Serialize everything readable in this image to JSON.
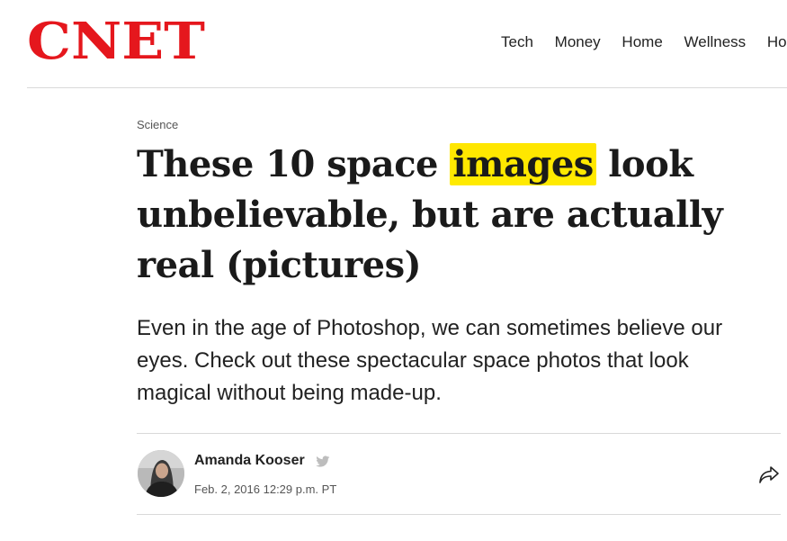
{
  "site": {
    "logo_text": "CNET",
    "brand_color": "#e5171d"
  },
  "nav": {
    "items": [
      "Tech",
      "Money",
      "Home",
      "Wellness",
      "Home Tips"
    ]
  },
  "article": {
    "section": "Science",
    "headline": {
      "before": "These 10 space ",
      "highlighted": "images",
      "after": " look unbelievable, but are actually real (pictures)"
    },
    "highlight_color": "#ffe600",
    "dek": "Even in the age of Photoshop, we can sometimes believe our eyes. Check out these spectacular space photos that look magical without being made-up.",
    "author": "Amanda Kooser",
    "timestamp": "Feb. 2, 2016 12:29 p.m. PT"
  },
  "icons": {
    "social": "twitter-icon",
    "share": "share-icon"
  }
}
